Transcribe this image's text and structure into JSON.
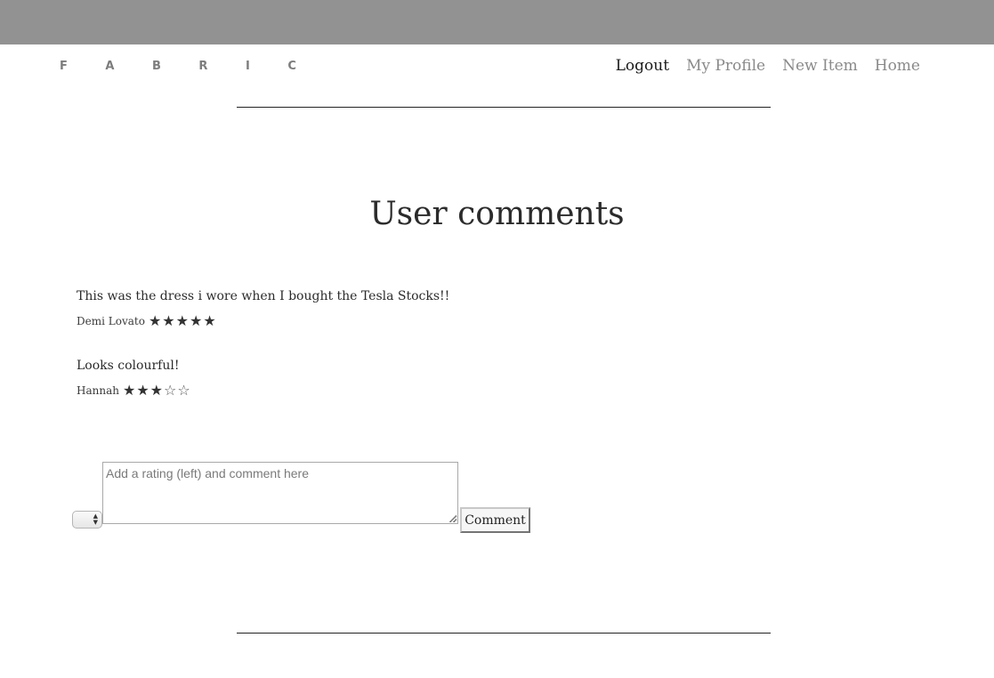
{
  "header": {
    "logo": "F A B R I C",
    "nav": [
      {
        "label": "Logout",
        "active": true
      },
      {
        "label": "My Profile",
        "active": false
      },
      {
        "label": "New Item",
        "active": false
      },
      {
        "label": "Home",
        "active": false
      }
    ]
  },
  "main": {
    "title": "User comments",
    "comments": [
      {
        "text": "This was the dress i wore when I bought the Tesla Stocks!!",
        "author": "Demi Lovato",
        "rating": 5,
        "max": 5
      },
      {
        "text": "Looks colourful!",
        "author": "Hannah",
        "rating": 3,
        "max": 5
      }
    ]
  },
  "form": {
    "rating_value": "",
    "placeholder": "Add a rating (left) and comment here",
    "submit_label": "Comment"
  },
  "colors": {
    "topbar": "#929292",
    "nav_inactive": "#8a8a8a",
    "nav_active": "#1b1b1b"
  }
}
